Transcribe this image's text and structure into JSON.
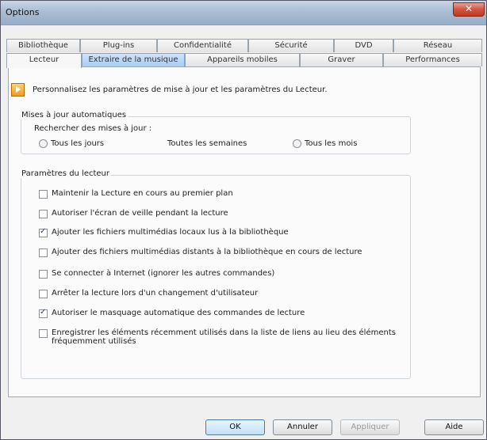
{
  "window": {
    "title": "Options"
  },
  "tabs": {
    "row1": [
      "Bibliothèque",
      "Plug-ins",
      "Confidentialité",
      "Sécurité",
      "DVD",
      "Réseau"
    ],
    "row2": [
      "Lecteur",
      "Extraire de la musique",
      "Appareils mobiles",
      "Graver",
      "Performances"
    ]
  },
  "header": {
    "text": "Personnalisez les paramètres de mise à jour et les paramètres du Lecteur."
  },
  "updates": {
    "group_label": "Mises à jour automatiques",
    "sub_label": "Rechercher des mises à jour :",
    "options": [
      "Tous les jours",
      "Toutes les semaines",
      "Tous les mois"
    ]
  },
  "player_settings": {
    "group_label": "Paramètres du lecteur",
    "checkboxes": [
      {
        "label": "Maintenir la Lecture en cours au premier plan",
        "checked": false
      },
      {
        "label": "Autoriser l'écran de veille pendant la lecture",
        "checked": false
      },
      {
        "label": "Ajouter les fichiers multimédias locaux lus à la bibliothèque",
        "checked": true
      },
      {
        "label": "Ajouter des fichiers multimédias distants à la bibliothèque en cours de lecture",
        "checked": false
      },
      {
        "label": "Se connecter à Internet (ignorer les autres commandes)",
        "checked": false
      },
      {
        "label": "Arrêter la lecture lors d'un changement d'utilisateur",
        "checked": false
      },
      {
        "label": "Autoriser le masquage automatique des commandes de lecture",
        "checked": true
      },
      {
        "label": "Enregistrer les éléments récemment utilisés dans la liste de liens au lieu des éléments fréquemment utilisés",
        "checked": false
      }
    ]
  },
  "buttons": {
    "ok": "OK",
    "cancel": "Annuler",
    "apply": "Appliquer",
    "help": "Aide"
  }
}
